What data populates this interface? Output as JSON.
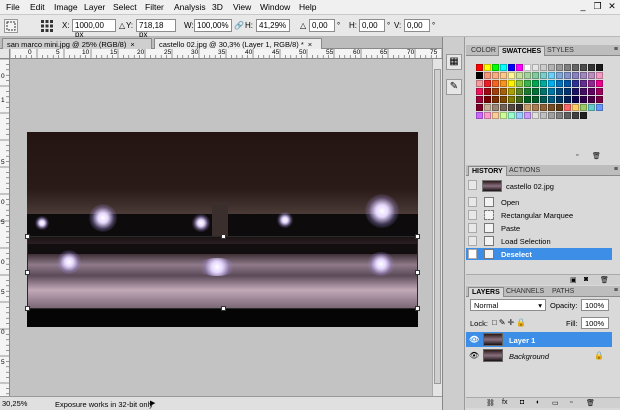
{
  "menu": [
    "File",
    "Edit",
    "Image",
    "Layer",
    "Select",
    "Filter",
    "Analysis",
    "3D",
    "View",
    "Window",
    "Help"
  ],
  "window_controls": {
    "minimize": "_",
    "restore": "❐",
    "close": "✕"
  },
  "options": {
    "x_label": "X:",
    "x_value": "1000,00 px",
    "y_label": "Y:",
    "y_value": "718,18 px",
    "w_label": "W:",
    "w_value": "100,00%",
    "h_label": "H:",
    "h_value": "41,29%",
    "rot_label": "△",
    "rot_value": "0,00",
    "hskew_label": "H:",
    "hskew_value": "0,00",
    "vskew_label": "V:",
    "vskew_value": "0,00",
    "degree": "°",
    "link": "🔗"
  },
  "tabs": [
    {
      "label": "san marco mini.jpg @ 25% (RGB/8)",
      "close": "×",
      "active": false
    },
    {
      "label": "castello 02.jpg @ 30,3% (Layer 1, RGB/8) *",
      "close": "×",
      "active": true
    }
  ],
  "ruler_h": [
    "0",
    "5",
    "10",
    "15",
    "20",
    "25",
    "30",
    "35",
    "40",
    "45",
    "50",
    "55",
    "60",
    "65",
    "70",
    "75"
  ],
  "ruler_v": [
    "0",
    "1",
    "5",
    "0",
    "5",
    "0",
    "5",
    "0",
    "5"
  ],
  "status": {
    "zoom": "30,25%",
    "message": "Exposure works in 32-bit only",
    "arrow": "▶"
  },
  "swatches_panel": {
    "tabs": [
      "COLOR",
      "SWATCHES",
      "STYLES"
    ],
    "active_tab": "SWATCHES",
    "colors": [
      "#ff0000",
      "#ffff00",
      "#00ff00",
      "#00ffff",
      "#0000ff",
      "#ff00ff",
      "#ffffff",
      "#e5e5e5",
      "#cccccc",
      "#b2b2b2",
      "#999999",
      "#7f7f7f",
      "#666666",
      "#4c4c4c",
      "#333333",
      "#191919",
      "#000000",
      "#f7977a",
      "#f9ad81",
      "#fdc68a",
      "#fff79a",
      "#c4df9b",
      "#a3d39c",
      "#82ca9d",
      "#7bcdc8",
      "#6ecff6",
      "#7ea7d8",
      "#8493ca",
      "#8882be",
      "#a187be",
      "#bc8dbf",
      "#f49ac2",
      "#f6989d",
      "#ed1c24",
      "#f26522",
      "#f7941d",
      "#fff200",
      "#8dc63f",
      "#39b54a",
      "#00a651",
      "#00a99d",
      "#00aeef",
      "#0072bc",
      "#0054a6",
      "#2e3192",
      "#662d91",
      "#92278f",
      "#ec008c",
      "#ed145b",
      "#9e0b0f",
      "#a0410d",
      "#a36209",
      "#aba000",
      "#598527",
      "#1a7b30",
      "#007236",
      "#00746b",
      "#0076a3",
      "#004a80",
      "#003471",
      "#1b1464",
      "#440e62",
      "#630460",
      "#9e005d",
      "#9e0039",
      "#790000",
      "#7b2e00",
      "#7d4900",
      "#827b00",
      "#406618",
      "#005e20",
      "#005826",
      "#005952",
      "#005b7f",
      "#003663",
      "#002157",
      "#0d004c",
      "#32004b",
      "#4b0049",
      "#7b0046",
      "#7a0026",
      "#c7b299",
      "#998675",
      "#736357",
      "#534741",
      "#37302d",
      "#c69c6d",
      "#a67c52",
      "#8c6239",
      "#754c24",
      "#603913",
      "#ff6666",
      "#ffcc66",
      "#99cc66",
      "#66cccc",
      "#6699ff",
      "#cc66ff",
      "#ff99cc",
      "#ffcc99",
      "#ccff99",
      "#99ffcc",
      "#99ccff",
      "#cc99ff",
      "#e0e0e0",
      "#c0c0c0",
      "#a0a0a0",
      "#808080",
      "#606060",
      "#404040",
      "#202020"
    ]
  },
  "history_panel": {
    "tabs": [
      "HISTORY",
      "ACTIONS"
    ],
    "active_tab": "HISTORY",
    "snapshot": "castello 02.jpg",
    "items": [
      "Open",
      "Rectangular Marquee",
      "Paste",
      "Load Selection",
      "Deselect"
    ],
    "selected": "Deselect"
  },
  "layers_panel": {
    "tabs": [
      "LAYERS",
      "CHANNELS",
      "PATHS"
    ],
    "active_tab": "LAYERS",
    "blend_mode": "Normal",
    "opacity_label": "Opacity:",
    "opacity": "100%",
    "fill_label": "Fill:",
    "fill": "100%",
    "lock_label": "Lock:",
    "layers": [
      {
        "name": "Layer 1",
        "selected": true
      },
      {
        "name": "Background",
        "selected": false
      }
    ],
    "lock_icon": "🔒"
  },
  "colors": {
    "selection_blue": "#3c8ee6"
  }
}
